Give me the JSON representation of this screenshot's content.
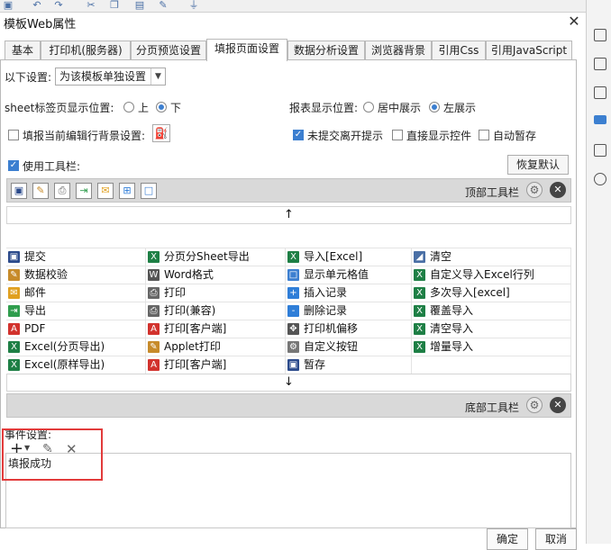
{
  "title": "模板Web属性",
  "tabs": [
    {
      "label": "基本"
    },
    {
      "label": "打印机(服务器)"
    },
    {
      "label": "分页预览设置"
    },
    {
      "label": "填报页面设置"
    },
    {
      "label": "数据分析设置"
    },
    {
      "label": "浏览器背景"
    },
    {
      "label": "引用Css"
    },
    {
      "label": "引用JavaScript"
    }
  ],
  "active_tab": "填报页面设置",
  "settings": {
    "mode_label": "以下设置:",
    "mode_value": "为该模板单独设置",
    "sheet_pos_label": "sheet标签页显示位置:",
    "sheet_pos_top": "上",
    "sheet_pos_bottom": "下",
    "report_pos_label": "报表显示位置:",
    "report_pos_center": "居中展示",
    "report_pos_left": "左展示",
    "row_bg_label": "填报当前编辑行背景设置:",
    "unsubmit_label": "未提交离开提示",
    "direct_ctrl_label": "直接显示控件",
    "autosave_label": "自动暂存",
    "use_toolbar_label": "使用工具栏:",
    "reset_label": "恢复默认"
  },
  "toolbar": {
    "top_label": "顶部工具栏",
    "bottom_label": "底部工具栏"
  },
  "buttons_grid": [
    [
      {
        "text": "提交",
        "icon": "save-icon",
        "color": "#2b4a8b"
      },
      {
        "text": "分页分Sheet导出",
        "icon": "excel-icon",
        "color": "#1e7f45"
      },
      {
        "text": "导入[Excel]",
        "icon": "excel-icon",
        "color": "#1e7f45"
      },
      {
        "text": "清空",
        "icon": "eraser-icon",
        "color": "#4a6fa5"
      }
    ],
    [
      {
        "text": "数据校验",
        "icon": "pencil-icon",
        "color": "#c78b2b"
      },
      {
        "text": "Word格式",
        "icon": "word-icon",
        "color": "#555555"
      },
      {
        "text": "显示单元格值",
        "icon": "cell-icon",
        "color": "#3c7fd0"
      },
      {
        "text": "自定义导入Excel行列",
        "icon": "excel-icon",
        "color": "#1e7f45"
      }
    ],
    [
      {
        "text": "邮件",
        "icon": "mail-icon",
        "color": "#e0a020"
      },
      {
        "text": "打印",
        "icon": "print-icon",
        "color": "#666666"
      },
      {
        "text": "插入记录",
        "icon": "insert-row-icon",
        "color": "#2f7ed8"
      },
      {
        "text": "多次导入[excel]",
        "icon": "excel-icon",
        "color": "#1e7f45"
      }
    ],
    [
      {
        "text": "导出",
        "icon": "export-icon",
        "color": "#2f9d4d"
      },
      {
        "text": "打印(兼容)",
        "icon": "print-icon",
        "color": "#666666"
      },
      {
        "text": "删除记录",
        "icon": "delete-row-icon",
        "color": "#2f7ed8"
      },
      {
        "text": "覆盖导入",
        "icon": "excel-icon",
        "color": "#1e7f45"
      }
    ],
    [
      {
        "text": "PDF",
        "icon": "pdf-icon",
        "color": "#d2322d"
      },
      {
        "text": "打印[客户端]",
        "icon": "pdf-icon",
        "color": "#d2322d"
      },
      {
        "text": "打印机偏移",
        "icon": "move-icon",
        "color": "#555555"
      },
      {
        "text": "清空导入",
        "icon": "excel-icon",
        "color": "#1e7f45"
      }
    ],
    [
      {
        "text": "Excel(分页导出)",
        "icon": "excel-icon",
        "color": "#1e7f45"
      },
      {
        "text": "Applet打印",
        "icon": "pencil-icon",
        "color": "#c78b2b"
      },
      {
        "text": "自定义按钮",
        "icon": "gear-icon",
        "color": "#777777"
      },
      {
        "text": "增量导入",
        "icon": "excel-icon",
        "color": "#1e7f45"
      }
    ],
    [
      {
        "text": "Excel(原样导出)",
        "icon": "excel-icon",
        "color": "#1e7f45"
      },
      {
        "text": "打印[客户端]",
        "icon": "pdf-icon",
        "color": "#d2322d"
      },
      {
        "text": "暂存",
        "icon": "save-icon",
        "color": "#2b4a8b"
      },
      {
        "text": "",
        "icon": "",
        "color": "#ffffff"
      }
    ]
  ],
  "events": {
    "label": "事件设置:",
    "items": [
      "填报成功"
    ]
  },
  "footer": {
    "ok": "确定",
    "cancel": "取消"
  }
}
